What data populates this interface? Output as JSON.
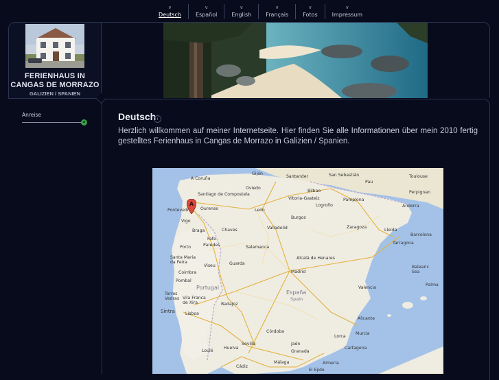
{
  "nav": {
    "items": [
      {
        "label": "Deutsch",
        "active": true
      },
      {
        "label": "Español",
        "active": false
      },
      {
        "label": "English",
        "active": false
      },
      {
        "label": "Français",
        "active": false
      },
      {
        "label": "Fotos",
        "active": false
      },
      {
        "label": "Impressum",
        "active": false
      }
    ]
  },
  "site": {
    "title": "FERIENHAUS IN CANGAS DE MORRAZO",
    "subtitle": "GALIZIEN / SPANIEN"
  },
  "sidebar": {
    "link_label": "Anreise",
    "bullet_icon": "arrow-bullet-icon"
  },
  "main": {
    "heading": "Deutsch",
    "intro": "Herzlich willkommen  auf meiner Internetseite.  Hier finden Sie alle Informationen über mein 2010 fertig gestelltes Ferienhaus in Cangas de Morrazo in Galizien / Spanien."
  },
  "map": {
    "marker_label": "A",
    "countries": {
      "portugal": "Portugal",
      "espana": "España",
      "spain": "Spain"
    },
    "cities": {
      "a_coruna": "A Coruña",
      "gijon": "Gijón",
      "santander": "Santander",
      "san_sebastian": "San Sebastián",
      "pau": "Pau",
      "toulouse": "Toulouse",
      "santiago": "Santiago de Compostela",
      "oviedo": "Oviedo",
      "bilbao": "Bilbao",
      "vitoria": "Vitoria-Gasteiz",
      "pamplona": "Pamplona",
      "perpignan": "Perpignan",
      "andorra": "Andorra",
      "pontevedra": "Pontevedra",
      "ourense": "Ourense",
      "leon": "León",
      "logrono": "Logroño",
      "burgos": "Burgos",
      "vigo": "Vigo",
      "valladolid": "Valladolid",
      "zaragoza": "Zaragoza",
      "lleida": "Lleida",
      "braga": "Braga",
      "chaves": "Chaves",
      "barcelona": "Barcelona",
      "tarragona": "Tarragona",
      "porto": "Porto",
      "fafe": "Fafe",
      "paredes": "Paredes",
      "salamanca": "Salamanca",
      "alcala": "Alcalá de Henares",
      "santa_maria": "Santa Maria da Feira",
      "viseu": "Viseu",
      "guarda": "Guarda",
      "coimbra": "Coimbra",
      "madrid": "Madrid",
      "pombal": "Pombal",
      "valencia": "Valencia",
      "balearic": "Balearic Sea",
      "torres_vedras": "Torres Vedras",
      "vila_franca": "Vila Franca de Xira",
      "badajoz": "Badajoz",
      "palma": "Palma",
      "sintra": "Sintra",
      "lisboa": "Lisboa",
      "alicante": "Alicante",
      "cordoba": "Córdoba",
      "murcia": "Murcia",
      "lorca": "Lorca",
      "cartagena": "Cartagena",
      "loule": "Loulé",
      "sevilla": "Sevilla",
      "huelva": "Huelva",
      "jaen": "Jaén",
      "granada": "Granada",
      "malaga": "Málaga",
      "almeria": "Almería",
      "cadiz": "Cádiz",
      "el_ejido": "El Ejido"
    }
  },
  "colors": {
    "background": "#070b1c",
    "frame_border": "#2b3450",
    "bullet_green": "#3aa14a",
    "map_land": "#e9e6dc",
    "map_sea": "#a4c2e8",
    "map_marker": "#d84a3b"
  }
}
